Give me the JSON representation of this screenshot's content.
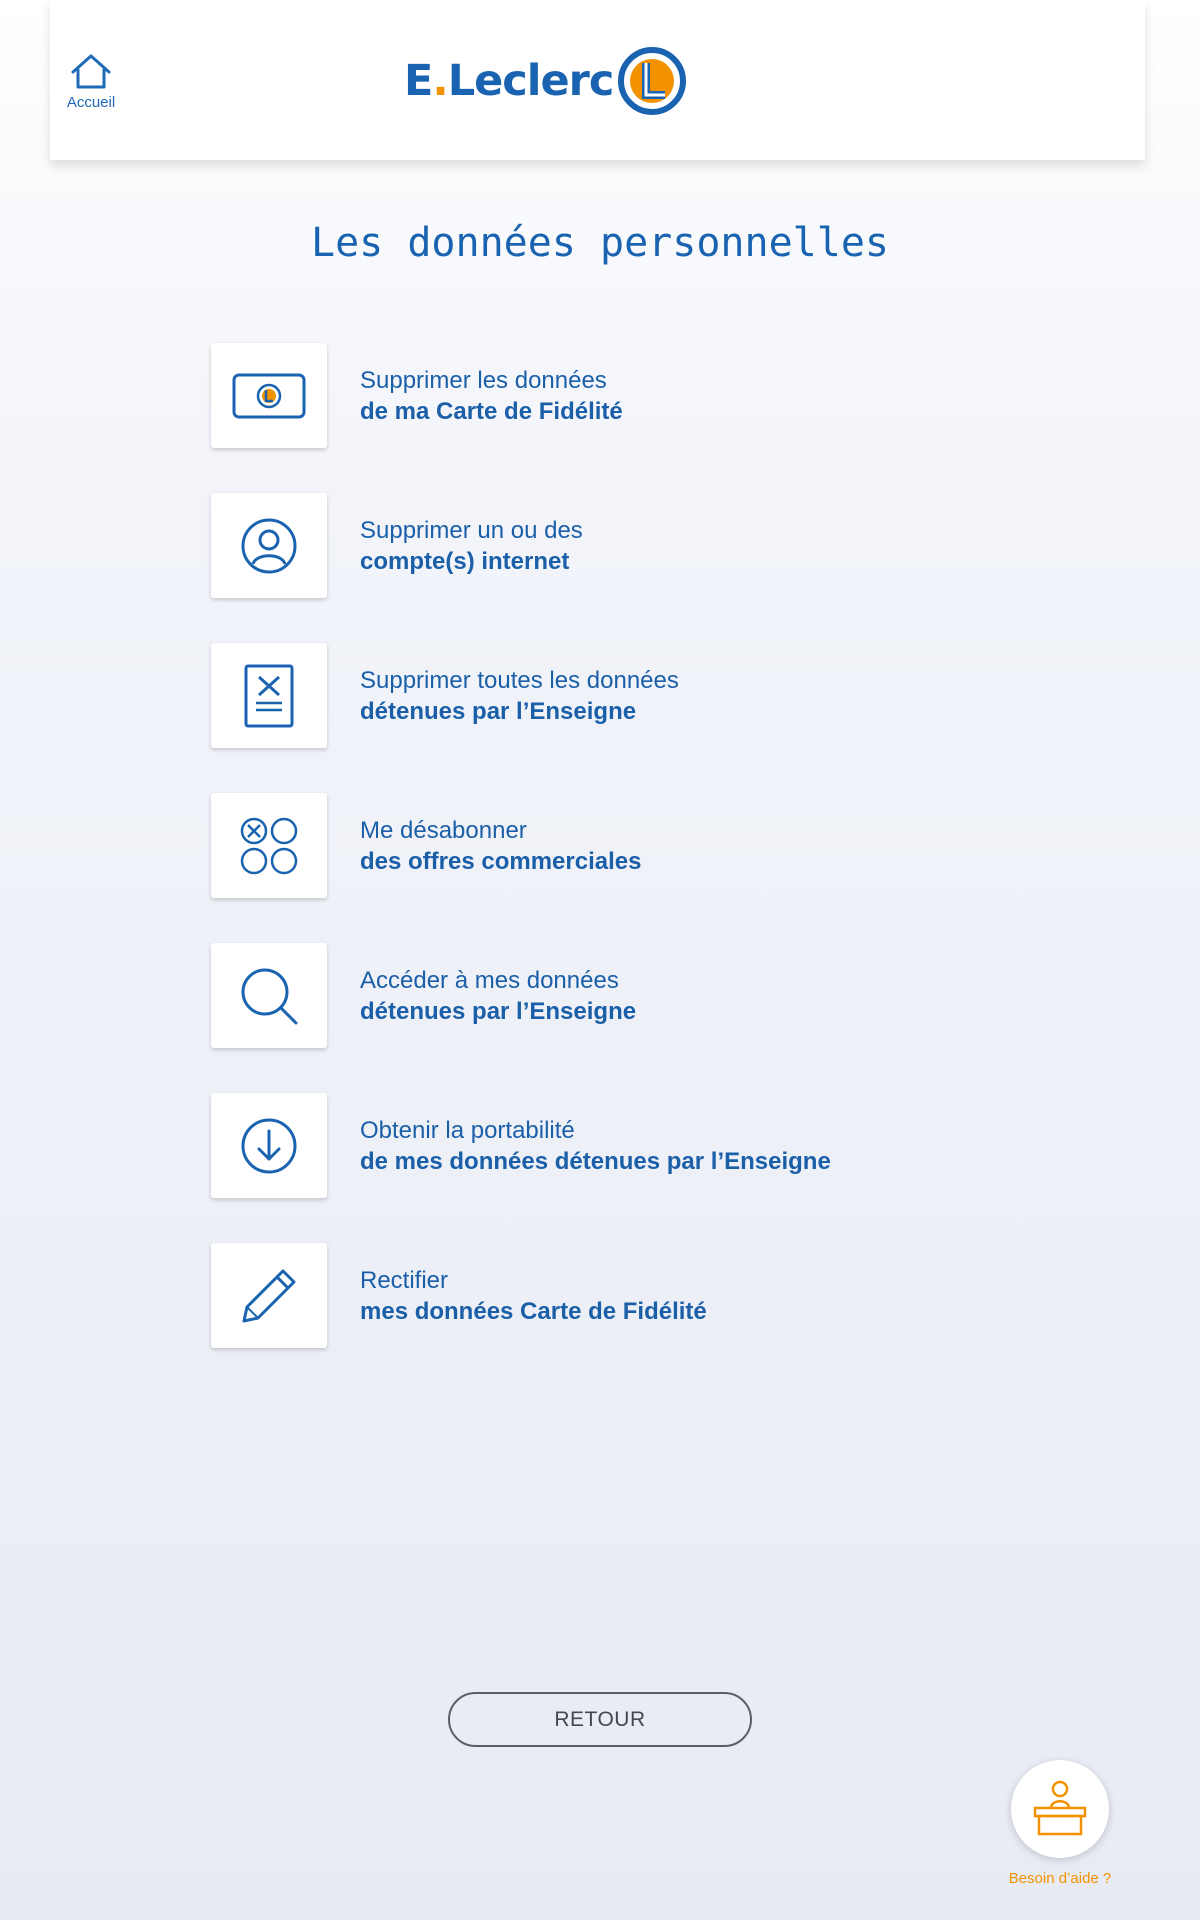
{
  "header": {
    "home_label": "Accueil",
    "logo_text_before_dot": "E",
    "logo_dot": ".",
    "logo_text_after_dot": "Leclerc",
    "brand_blue": "#1a63b0",
    "brand_orange": "#f39200"
  },
  "page_title": "Les données personnelles",
  "menu": {
    "items": [
      {
        "icon": "loyalty-card-icon",
        "line1": "Supprimer les données",
        "line2": "de ma Carte de Fidélité"
      },
      {
        "icon": "user-account-icon",
        "line1": "Supprimer un ou des",
        "line2": "compte(s) internet"
      },
      {
        "icon": "delete-document-icon",
        "line1": "Supprimer toutes les données",
        "line2": "détenues par l’Enseigne"
      },
      {
        "icon": "unsubscribe-offers-icon",
        "line1": "Me désabonner",
        "line2": "des offres commerciales"
      },
      {
        "icon": "search-icon",
        "line1": "Accéder à mes données",
        "line2": "détenues par l’Enseigne"
      },
      {
        "icon": "download-icon",
        "line1": "Obtenir la portabilité",
        "line2": "de mes données détenues par l’Enseigne"
      },
      {
        "icon": "pencil-icon",
        "line1": "Rectifier",
        "line2": "mes données Carte de Fidélité"
      }
    ]
  },
  "retour_label": "RETOUR",
  "help_label": "Besoin d’aide ?"
}
